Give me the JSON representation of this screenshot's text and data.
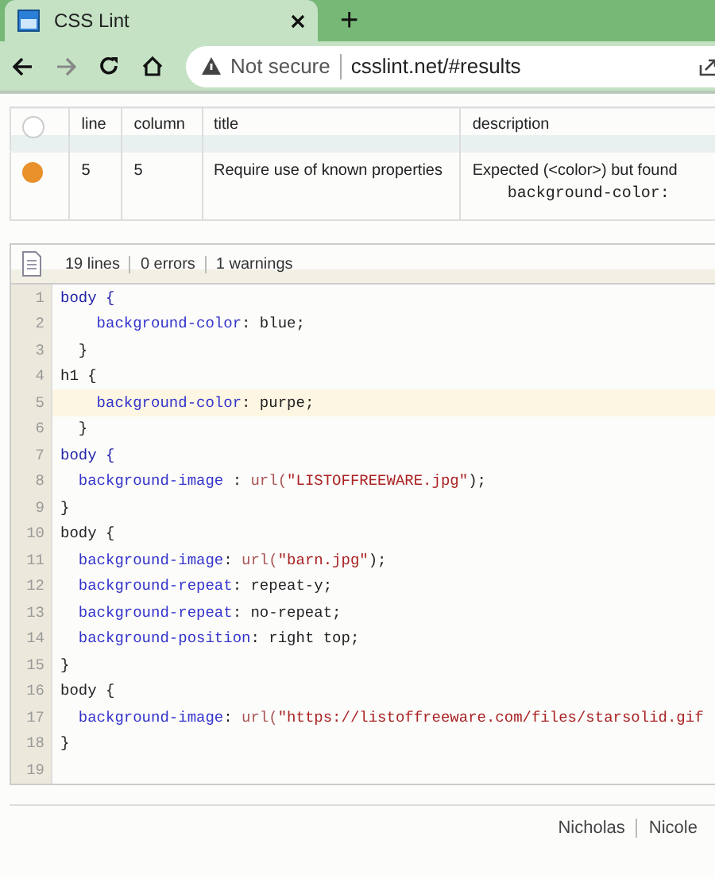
{
  "browser": {
    "tab": {
      "title": "CSS Lint",
      "selected": true
    },
    "new_tab": "+",
    "security": "Not secure",
    "url": "csslint.net/#results"
  },
  "results": {
    "columns": [
      "line",
      "column",
      "title",
      "description"
    ],
    "rows": [
      {
        "kind": "warning",
        "line": "5",
        "column": "5",
        "title": "Require use of known properties",
        "description": "Expected (<color>) but found",
        "code": "background-color:"
      }
    ]
  },
  "summary": [
    "19 lines",
    "0 errors",
    "1 warnings"
  ],
  "code": [
    {
      "number": "1",
      "highlighted": false,
      "tokens": [
        {
          "kind": "selector",
          "text": "body {"
        }
      ]
    },
    {
      "number": "2",
      "highlighted": false,
      "tokens": [
        {
          "kind": "property",
          "text": "    background-color"
        },
        {
          "kind": "plain",
          "text": ": blue;"
        }
      ]
    },
    {
      "number": "3",
      "highlighted": false,
      "tokens": [
        {
          "kind": "plain",
          "text": "  }"
        }
      ]
    },
    {
      "number": "4",
      "highlighted": false,
      "tokens": [
        {
          "kind": "plain",
          "text": "h1 {"
        }
      ]
    },
    {
      "number": "5",
      "highlighted": true,
      "tokens": [
        {
          "kind": "property",
          "text": "    background-color"
        },
        {
          "kind": "plain",
          "text": ": purpe;"
        }
      ]
    },
    {
      "number": "6",
      "highlighted": false,
      "tokens": [
        {
          "kind": "plain",
          "text": "  }"
        }
      ]
    },
    {
      "number": "7",
      "highlighted": false,
      "tokens": [
        {
          "kind": "selector",
          "text": "body {"
        }
      ]
    },
    {
      "number": "8",
      "highlighted": false,
      "tokens": [
        {
          "kind": "property",
          "text": "  background-image"
        },
        {
          "kind": "plain",
          "text": " : "
        },
        {
          "kind": "func",
          "text": "url("
        },
        {
          "kind": "string",
          "text": "\"LISTOFFREEWARE.jpg\""
        },
        {
          "kind": "plain",
          "text": ");"
        }
      ]
    },
    {
      "number": "9",
      "highlighted": false,
      "tokens": [
        {
          "kind": "plain",
          "text": "}"
        }
      ]
    },
    {
      "number": "10",
      "highlighted": false,
      "tokens": [
        {
          "kind": "plain",
          "text": "body {"
        }
      ]
    },
    {
      "number": "11",
      "highlighted": false,
      "tokens": [
        {
          "kind": "property",
          "text": "  background-image"
        },
        {
          "kind": "plain",
          "text": ": "
        },
        {
          "kind": "func",
          "text": "url("
        },
        {
          "kind": "string",
          "text": "\"barn.jpg\""
        },
        {
          "kind": "plain",
          "text": ");"
        }
      ]
    },
    {
      "number": "12",
      "highlighted": false,
      "tokens": [
        {
          "kind": "property",
          "text": "  background-repeat"
        },
        {
          "kind": "plain",
          "text": ": repeat-y;"
        }
      ]
    },
    {
      "number": "13",
      "highlighted": false,
      "tokens": [
        {
          "kind": "property",
          "text": "  background-repeat"
        },
        {
          "kind": "plain",
          "text": ": no-repeat;"
        }
      ]
    },
    {
      "number": "14",
      "highlighted": false,
      "tokens": [
        {
          "kind": "property",
          "text": "  background-position"
        },
        {
          "kind": "plain",
          "text": ": right top;"
        }
      ]
    },
    {
      "number": "15",
      "highlighted": false,
      "tokens": [
        {
          "kind": "plain",
          "text": "}"
        }
      ]
    },
    {
      "number": "16",
      "highlighted": false,
      "tokens": [
        {
          "kind": "plain",
          "text": "body {"
        }
      ]
    },
    {
      "number": "17",
      "highlighted": false,
      "tokens": [
        {
          "kind": "property",
          "text": "  background-image"
        },
        {
          "kind": "plain",
          "text": ": "
        },
        {
          "kind": "func",
          "text": "url("
        },
        {
          "kind": "string",
          "text": "\"https://listoffreeware.com/files/starsolid.gif"
        }
      ]
    },
    {
      "number": "18",
      "highlighted": false,
      "tokens": [
        {
          "kind": "plain",
          "text": "}"
        }
      ]
    },
    {
      "number": "19",
      "highlighted": false
    }
  ],
  "footer": [
    "Nicholas",
    "Nicole"
  ]
}
